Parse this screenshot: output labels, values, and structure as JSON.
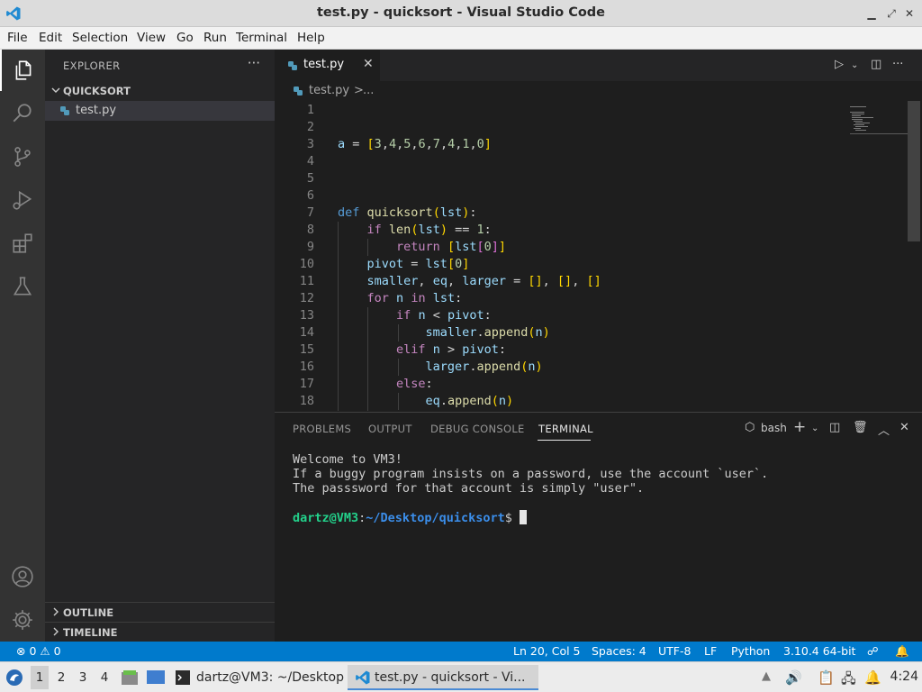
{
  "window": {
    "title": "test.py - quicksort - Visual Studio Code"
  },
  "menu": [
    "File",
    "Edit",
    "Selection",
    "View",
    "Go",
    "Run",
    "Terminal",
    "Help"
  ],
  "sidebar": {
    "header": "EXPLORER",
    "more": "···",
    "folder": "QUICKSORT",
    "file": "test.py",
    "outline": "OUTLINE",
    "timeline": "TIMELINE"
  },
  "editor": {
    "tab_label": "test.py",
    "tab_close": "✕",
    "breadcrumb_file": "test.py",
    "breadcrumb_sep": ">",
    "breadcrumb_more": "...",
    "line_numbers": [
      "1",
      "2",
      "3",
      "4",
      "5",
      "6",
      "7",
      "8",
      "9",
      "10",
      "11",
      "12",
      "13",
      "14",
      "15",
      "16",
      "17",
      "18"
    ]
  },
  "panel": {
    "tabs": [
      "PROBLEMS",
      "OUTPUT",
      "DEBUG CONSOLE",
      "TERMINAL"
    ],
    "shell": "bash",
    "terminal_lines": [
      "Welcome to VM3!",
      "If a buggy program insists on a password, use the account `user`.",
      "The passsword for that account is simply \"user\"."
    ],
    "prompt_user": "dartz@VM3",
    "prompt_colon": ":",
    "prompt_path": "~/Desktop/quicksort",
    "prompt_symbol": "$"
  },
  "statusbar": {
    "errors": "0",
    "warnings": "0",
    "position": "Ln 20, Col 5",
    "spaces": "Spaces: 4",
    "encoding": "UTF-8",
    "eol": "LF",
    "language": "Python",
    "interpreter": "3.10.4 64-bit"
  },
  "taskbar": {
    "workspaces": [
      "1",
      "2",
      "3",
      "4"
    ],
    "terminal_task": "dartz@VM3: ~/Desktop",
    "vscode_task": "test.py - quicksort - Vi...",
    "clock": "4:24"
  },
  "colors": {
    "accent": "#007acc",
    "editor_bg": "#1e1e1e",
    "sidebar_bg": "#252526",
    "activity_bg": "#333333"
  }
}
